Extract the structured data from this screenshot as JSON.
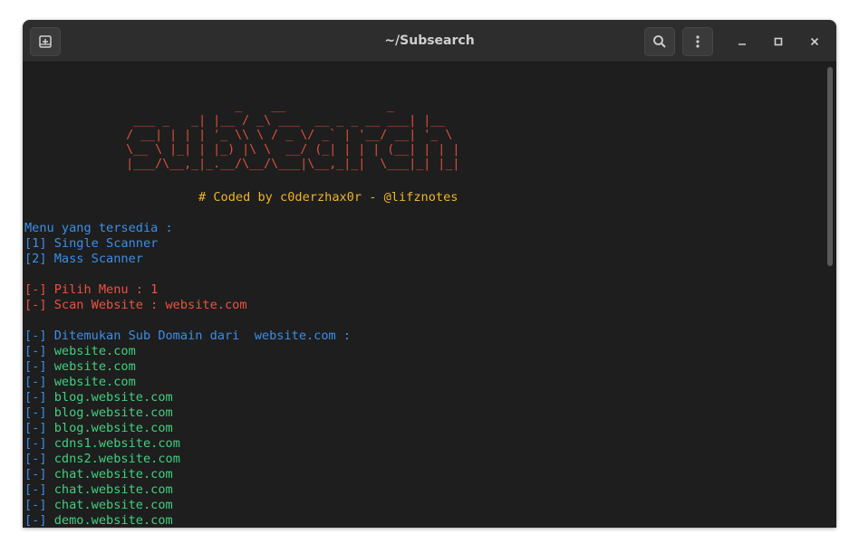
{
  "window": {
    "title": "~/Subsearch"
  },
  "icons": {
    "new_tab": "new-tab-icon",
    "search": "search-icon",
    "menu": "kebab-menu-icon",
    "minimize": "minimize-icon",
    "maximize": "maximize-icon",
    "close": "close-icon"
  },
  "colors": {
    "background": "#1e1e1e",
    "titlebar": "#2d2d2d",
    "banner": "#e0503c",
    "credit": "#f0b428",
    "menu_text": "#3b8eea",
    "prompt": "#f05040",
    "result_bracket": "#3b8eea",
    "result_domain": "#40d080"
  },
  "banner": {
    "ascii_lines": [
      "                             _    __              _      ",
      "               ___ _   _| |__ / _\\ ___  __ _ _ __ ___| |__  ",
      "              / __| | | | '_ \\\\ \\ / _ \\/ _` | '__/ __| '_ \\ ",
      "              \\__ \\ |_| | |_) |\\ \\  __/ (_| | | | (__| | | |",
      "              |___/\\__,_|_.__/\\__/\\___|\\__,_|_|  \\___|_| |_|"
    ],
    "credit": "# Coded by c0derzhax0r - @lifznotes"
  },
  "menu": {
    "header": "Menu yang tersedia :",
    "items": [
      "[1] Single Scanner",
      "[2] Mass Scanner"
    ]
  },
  "prompts": {
    "pilih_menu": "[-] Pilih Menu : 1",
    "scan_website": "[-] Scan Website : website.com"
  },
  "results": {
    "header": "[-] Ditemukan Sub Domain dari  website.com :",
    "bracket": "[-]",
    "domains": [
      "website.com",
      "website.com",
      "website.com",
      "blog.website.com",
      "blog.website.com",
      "blog.website.com",
      "cdns1.website.com",
      "cdns2.website.com",
      "chat.website.com",
      "chat.website.com",
      "chat.website.com",
      "demo.website.com"
    ]
  }
}
